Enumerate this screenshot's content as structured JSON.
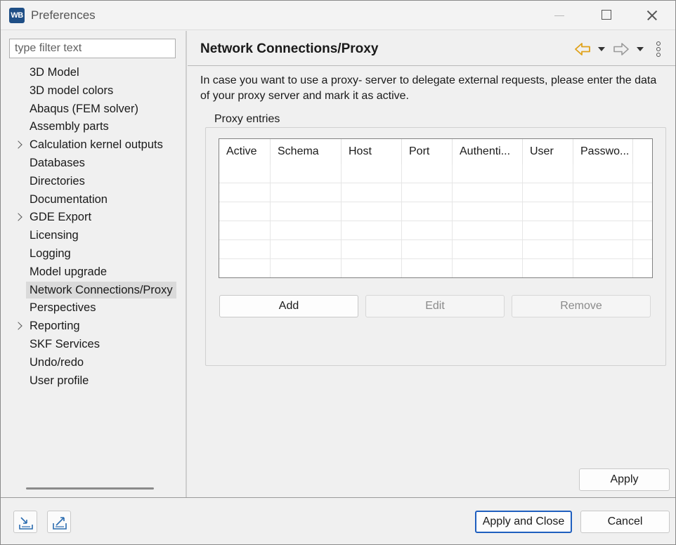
{
  "window": {
    "title": "Preferences",
    "app_icon_text": "WB"
  },
  "filter": {
    "placeholder": "type filter text"
  },
  "tree": {
    "items": [
      {
        "label": "3D Model",
        "expandable": false
      },
      {
        "label": "3D model colors",
        "expandable": false
      },
      {
        "label": "Abaqus (FEM solver)",
        "expandable": false
      },
      {
        "label": "Assembly parts",
        "expandable": false
      },
      {
        "label": "Calculation kernel outputs",
        "expandable": true
      },
      {
        "label": "Databases",
        "expandable": false
      },
      {
        "label": "Directories",
        "expandable": false
      },
      {
        "label": "Documentation",
        "expandable": false
      },
      {
        "label": "GDE Export",
        "expandable": true
      },
      {
        "label": "Licensing",
        "expandable": false
      },
      {
        "label": "Logging",
        "expandable": false
      },
      {
        "label": "Model upgrade",
        "expandable": false
      },
      {
        "label": "Network Connections/Proxy",
        "expandable": false,
        "selected": true
      },
      {
        "label": "Perspectives",
        "expandable": false
      },
      {
        "label": "Reporting",
        "expandable": true
      },
      {
        "label": "SKF Services",
        "expandable": false
      },
      {
        "label": "Undo/redo",
        "expandable": false
      },
      {
        "label": "User profile",
        "expandable": false
      }
    ]
  },
  "page": {
    "title": "Network Connections/Proxy",
    "description": "In case you want to use a proxy- server to delegate external requests, please enter the data of your proxy server and mark it as active.",
    "group_label": "Proxy entries",
    "table": {
      "columns": [
        "Active",
        "Schema",
        "Host",
        "Port",
        "Authenti...",
        "User",
        "Passwo..."
      ],
      "rows": []
    },
    "buttons": {
      "add": "Add",
      "edit": "Edit",
      "remove": "Remove",
      "apply": "Apply"
    }
  },
  "footer": {
    "apply_and_close": "Apply and Close",
    "cancel": "Cancel"
  },
  "icons": {
    "back": "back-arrow-icon",
    "forward": "forward-arrow-icon",
    "more": "more-vertical-icon",
    "import": "import-icon",
    "export": "export-icon"
  },
  "colors": {
    "accent": "#1f5fbf",
    "back_arrow": "#e0a21a",
    "selection": "#dadada"
  }
}
